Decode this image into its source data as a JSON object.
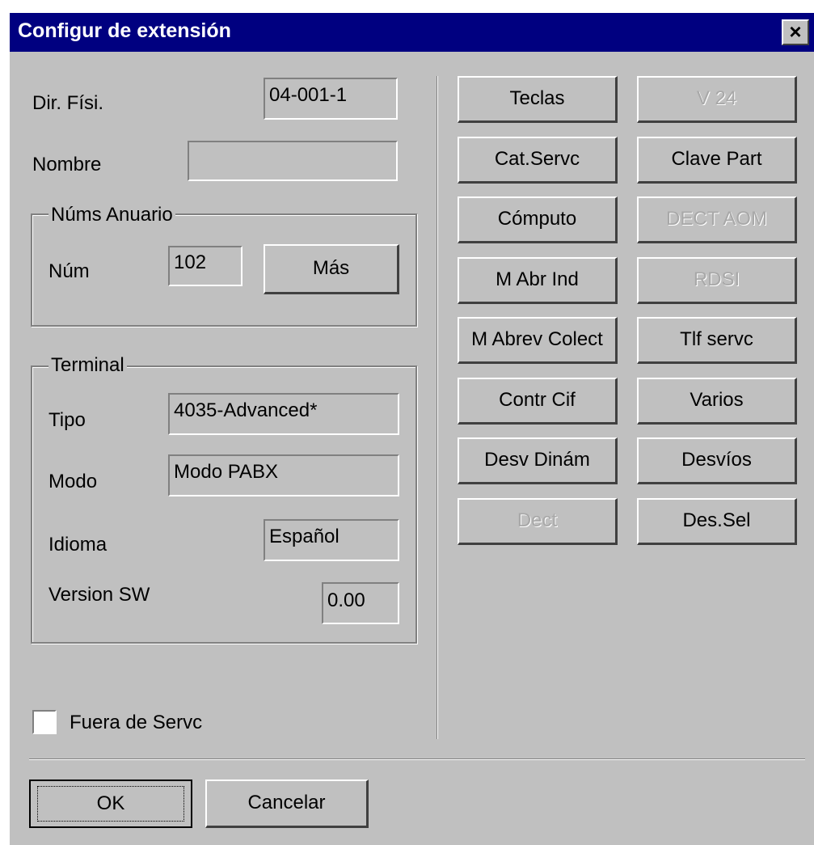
{
  "window": {
    "title": "Configur de extensión",
    "close_glyph": "×"
  },
  "fields": {
    "dir_fisi": {
      "label": "Dir. Físi.",
      "value": "04-001-1"
    },
    "nombre": {
      "label": "Nombre",
      "value": ""
    }
  },
  "nums_anuario": {
    "title": "Núms Anuario",
    "num_label": "Núm",
    "num_value": "102",
    "mas_button": "Más"
  },
  "terminal": {
    "title": "Terminal",
    "tipo_label": "Tipo",
    "tipo_value": "4035-Advanced*",
    "modo_label": "Modo",
    "modo_value": "Modo PABX",
    "idioma_label": "Idioma",
    "idioma_value": "Español",
    "version_label": "Version SW",
    "version_value": "0.00"
  },
  "fuera_servicio": {
    "label": "Fuera de Servc",
    "checked": false
  },
  "buttons_right": [
    {
      "label": "Teclas",
      "enabled": true
    },
    {
      "label": "V 24",
      "enabled": false
    },
    {
      "label": "Cat.Servc",
      "enabled": true
    },
    {
      "label": "Clave Part",
      "enabled": true
    },
    {
      "label": "Cómputo",
      "enabled": true
    },
    {
      "label": "DECT AOM",
      "enabled": false
    },
    {
      "label": "M Abr Ind",
      "enabled": true
    },
    {
      "label": "RDSI",
      "enabled": false
    },
    {
      "label": "M Abrev Colect",
      "enabled": true
    },
    {
      "label": "Tlf servc",
      "enabled": true
    },
    {
      "label": "Contr Cif",
      "enabled": true
    },
    {
      "label": "Varios",
      "enabled": true
    },
    {
      "label": "Desv Dinám",
      "enabled": true
    },
    {
      "label": "Desvíos",
      "enabled": true
    },
    {
      "label": "Dect",
      "enabled": false
    },
    {
      "label": "Des.Sel",
      "enabled": true
    }
  ],
  "footer": {
    "ok_label": "OK",
    "cancel_label": "Cancelar"
  },
  "colors": {
    "titlebar": "#000080",
    "face": "#c0c0c0",
    "disabled_text": "#a8a8a8"
  }
}
